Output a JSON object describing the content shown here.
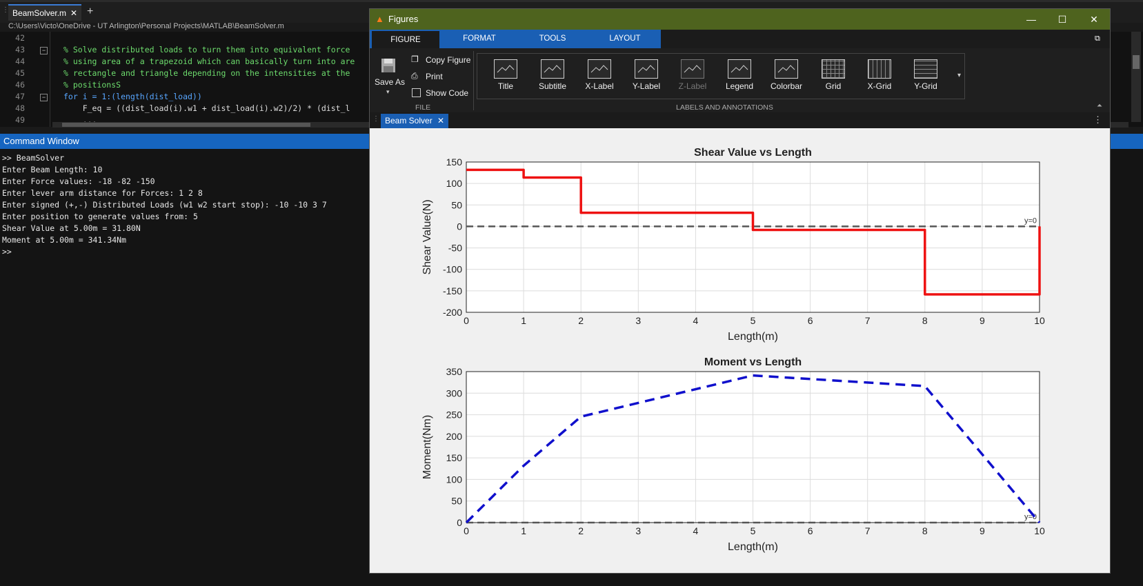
{
  "editor": {
    "tab_label": "BeamSolver.m",
    "tab_close": "✕",
    "add_tab": "+",
    "file_path": "C:\\Users\\Victo\\OneDrive - UT Arlington\\Personal Projects\\MATLAB\\BeamSolver.m",
    "lines": [
      {
        "num": "42",
        "text": ""
      },
      {
        "num": "43",
        "text": "% Solve distributed loads to turn them into equivalent force"
      },
      {
        "num": "44",
        "text": "% using area of a trapezoid which can basically turn into are"
      },
      {
        "num": "45",
        "text": "% rectangle and triangle depending on the intensities at the"
      },
      {
        "num": "46",
        "text": "% positionsS"
      },
      {
        "num": "47",
        "text": "for i = 1:(length(dist_load))"
      },
      {
        "num": "48",
        "text": "    F_eq = ((dist_load(i).w1 + dist_load(i).w2)/2) * (dist_l"
      },
      {
        "num": "49",
        "text": "    ..."
      }
    ]
  },
  "command_window": {
    "title": "Command Window",
    "lines": [
      ">> BeamSolver",
      "Enter Beam Length: 10",
      "Enter Force values: -18 -82 -150",
      "Enter lever arm distance for Forces: 1 2 8",
      "Enter signed (+,-) Distributed Loads (w1 w2 start stop): -10 -10 3 7",
      "Enter position to generate values from: 5",
      "Shear Value at 5.00m = 31.80N",
      "Moment at 5.00m = 341.34Nm",
      ">>"
    ]
  },
  "figure_window": {
    "title": "Figures",
    "minimize": "—",
    "maximize": "☐",
    "close": "✕",
    "ribbon_tabs": [
      "FIGURE",
      "FORMAT",
      "TOOLS",
      "LAYOUT"
    ],
    "file_section": {
      "save_as": "Save As",
      "copy_figure": "Copy Figure",
      "print": "Print",
      "show_code": "Show Code",
      "label": "FILE"
    },
    "gallery": [
      {
        "label": "Title",
        "enabled": true
      },
      {
        "label": "Subtitle",
        "enabled": true
      },
      {
        "label": "X-Label",
        "enabled": true
      },
      {
        "label": "Y-Label",
        "enabled": true
      },
      {
        "label": "Z-Label",
        "enabled": false
      },
      {
        "label": "Legend",
        "enabled": true
      },
      {
        "label": "Colorbar",
        "enabled": true
      },
      {
        "label": "Grid",
        "enabled": true
      },
      {
        "label": "X-Grid",
        "enabled": true
      },
      {
        "label": "Y-Grid",
        "enabled": true
      }
    ],
    "gallery_section_label": "LABELS AND ANNOTATIONS",
    "doc_tab": "Beam Solver",
    "doc_tab_close": "✕"
  },
  "chart_data": [
    {
      "type": "line",
      "title": "Shear Value vs Length",
      "xlabel": "Length(m)",
      "ylabel": "Shear Value(N)",
      "xlim": [
        0,
        10
      ],
      "ylim": [
        -200,
        150
      ],
      "xticks": [
        0,
        1,
        2,
        3,
        4,
        5,
        6,
        7,
        8,
        9,
        10
      ],
      "yticks": [
        150,
        100,
        50,
        0,
        -50,
        -100,
        -150,
        -200
      ],
      "grid": true,
      "series": [
        {
          "color": "#ee1111",
          "style": "solid",
          "x": [
            0,
            1,
            1,
            2,
            2,
            5,
            5,
            8,
            8,
            10,
            10
          ],
          "y": [
            131.8,
            131.8,
            113.8,
            113.8,
            31.8,
            31.8,
            -8.2,
            -8.2,
            -158.2,
            -158.2,
            0
          ]
        }
      ],
      "reference_line": {
        "y": 0,
        "label": "y=0",
        "color": "#555555",
        "style": "dashed"
      }
    },
    {
      "type": "line",
      "title": "Moment vs Length",
      "xlabel": "Length(m)",
      "ylabel": "Moment(Nm)",
      "xlim": [
        0,
        10
      ],
      "ylim": [
        0,
        350
      ],
      "xticks": [
        0,
        1,
        2,
        3,
        4,
        5,
        6,
        7,
        8,
        9,
        10
      ],
      "yticks": [
        350,
        300,
        250,
        200,
        150,
        100,
        50,
        0
      ],
      "grid": true,
      "series": [
        {
          "color": "#1010cc",
          "style": "dashed",
          "x": [
            0,
            1,
            2,
            3,
            4,
            5,
            6,
            7,
            8,
            9,
            10
          ],
          "y": [
            0,
            131.8,
            245.6,
            277.4,
            309.2,
            341.0,
            332.8,
            324.6,
            316.4,
            158.2,
            0
          ]
        }
      ],
      "reference_line": {
        "y": 0,
        "label": "y=0",
        "color": "#555555",
        "style": "dashed"
      }
    }
  ]
}
